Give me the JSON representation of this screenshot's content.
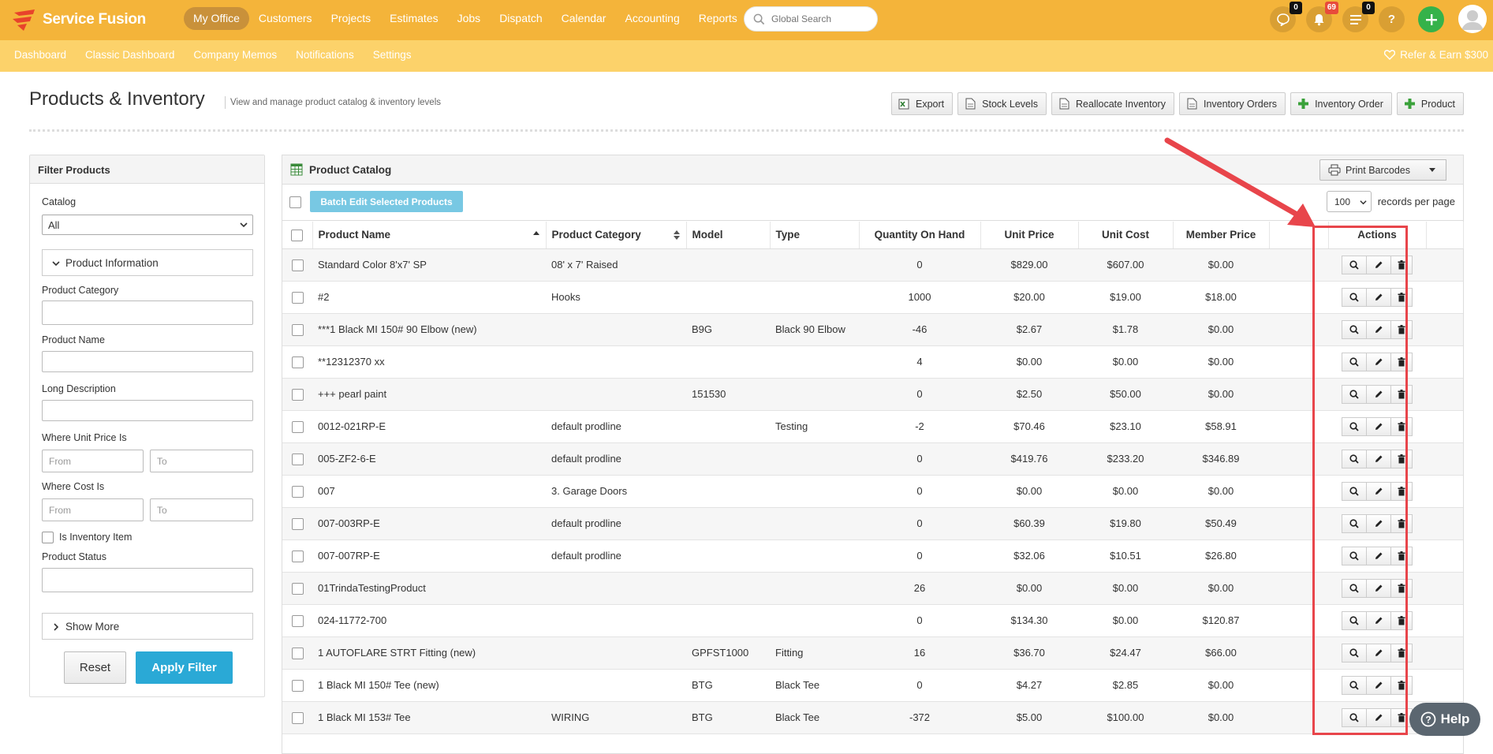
{
  "brand": {
    "name": "Service Fusion"
  },
  "topnav": {
    "items": [
      "My Office",
      "Customers",
      "Projects",
      "Estimates",
      "Jobs",
      "Dispatch",
      "Calendar",
      "Accounting",
      "Reports"
    ],
    "active": "My Office",
    "search_placeholder": "Global Search",
    "badges": {
      "chat": "0",
      "notifications": "69",
      "tasks": "0"
    },
    "help_label": "?"
  },
  "subnav": {
    "items": [
      "Dashboard",
      "Classic Dashboard",
      "Company Memos",
      "Notifications",
      "Settings"
    ],
    "refer": "Refer & Earn $300"
  },
  "page": {
    "title": "Products & Inventory",
    "subtitle": "View and manage product catalog & inventory levels",
    "buttons": [
      "Export",
      "Stock Levels",
      "Reallocate Inventory",
      "Inventory Orders",
      "Inventory Order",
      "Product"
    ]
  },
  "filter": {
    "title": "Filter Products",
    "catalog_label": "Catalog",
    "catalog_value": "All",
    "product_info_label": "Product Information",
    "category_label": "Product Category",
    "name_label": "Product Name",
    "long_desc_label": "Long Description",
    "unit_price_label": "Where Unit Price Is",
    "cost_label": "Where Cost Is",
    "from_placeholder": "From",
    "to_placeholder": "To",
    "inventory_item_label": "Is Inventory Item",
    "status_label": "Product Status",
    "show_more": "Show More",
    "reset": "Reset",
    "apply": "Apply Filter"
  },
  "catalog": {
    "title": "Product Catalog",
    "print_barcodes": "Print Barcodes",
    "batch_edit": "Batch Edit Selected Products",
    "records_per_page": "100",
    "records_label": "records per page",
    "columns": [
      "Product Name",
      "Product Category",
      "Model",
      "Type",
      "Quantity On Hand",
      "Unit Price",
      "Unit Cost",
      "Member Price",
      "Actions"
    ],
    "rows": [
      {
        "name": "Standard Color 8'x7' SP",
        "category": "08' x 7' Raised",
        "model": "",
        "type": "",
        "qty": "0",
        "price": "$829.00",
        "cost": "$607.00",
        "member": "$0.00"
      },
      {
        "name": "#2",
        "category": "Hooks",
        "model": "",
        "type": "",
        "qty": "1000",
        "price": "$20.00",
        "cost": "$19.00",
        "member": "$18.00"
      },
      {
        "name": "***1 Black MI 150# 90 Elbow (new)",
        "category": "",
        "model": "B9G",
        "type": "Black 90 Elbow",
        "qty": "-46",
        "price": "$2.67",
        "cost": "$1.78",
        "member": "$0.00"
      },
      {
        "name": "**12312370 xx",
        "category": "",
        "model": "",
        "type": "",
        "qty": "4",
        "price": "$0.00",
        "cost": "$0.00",
        "member": "$0.00"
      },
      {
        "name": "+++ pearl paint",
        "category": "",
        "model": "151530",
        "type": "",
        "qty": "0",
        "price": "$2.50",
        "cost": "$50.00",
        "member": "$0.00"
      },
      {
        "name": "0012-021RP-E",
        "category": "default prodline",
        "model": "",
        "type": "Testing",
        "qty": "-2",
        "price": "$70.46",
        "cost": "$23.10",
        "member": "$58.91"
      },
      {
        "name": "005-ZF2-6-E",
        "category": "default prodline",
        "model": "",
        "type": "",
        "qty": "0",
        "price": "$419.76",
        "cost": "$233.20",
        "member": "$346.89"
      },
      {
        "name": "007",
        "category": "3. Garage Doors",
        "model": "",
        "type": "",
        "qty": "0",
        "price": "$0.00",
        "cost": "$0.00",
        "member": "$0.00"
      },
      {
        "name": "007-003RP-E",
        "category": "default prodline",
        "model": "",
        "type": "",
        "qty": "0",
        "price": "$60.39",
        "cost": "$19.80",
        "member": "$50.49"
      },
      {
        "name": "007-007RP-E",
        "category": "default prodline",
        "model": "",
        "type": "",
        "qty": "0",
        "price": "$32.06",
        "cost": "$10.51",
        "member": "$26.80"
      },
      {
        "name": "01TrindaTestingProduct",
        "category": "",
        "model": "",
        "type": "",
        "qty": "26",
        "price": "$0.00",
        "cost": "$0.00",
        "member": "$0.00"
      },
      {
        "name": "024-11772-700",
        "category": "",
        "model": "",
        "type": "",
        "qty": "0",
        "price": "$134.30",
        "cost": "$0.00",
        "member": "$120.87"
      },
      {
        "name": "1 AUTOFLARE STRT Fitting (new)",
        "category": "",
        "model": "GPFST1000",
        "type": "Fitting",
        "qty": "16",
        "price": "$36.70",
        "cost": "$24.47",
        "member": "$66.00"
      },
      {
        "name": "1 Black MI 150# Tee (new)",
        "category": "",
        "model": "BTG",
        "type": "Black Tee",
        "qty": "0",
        "price": "$4.27",
        "cost": "$2.85",
        "member": "$0.00"
      },
      {
        "name": "1 Black MI 153# Tee",
        "category": "WIRING",
        "model": "BTG",
        "type": "Black Tee",
        "qty": "-372",
        "price": "$5.00",
        "cost": "$100.00",
        "member": "$0.00"
      }
    ]
  },
  "help": {
    "label": "Help"
  },
  "colors": {
    "topbar": "#f4b43a",
    "subbar": "#fcd26a",
    "accent": "#2aa9d6",
    "highlight": "#e8454b"
  }
}
